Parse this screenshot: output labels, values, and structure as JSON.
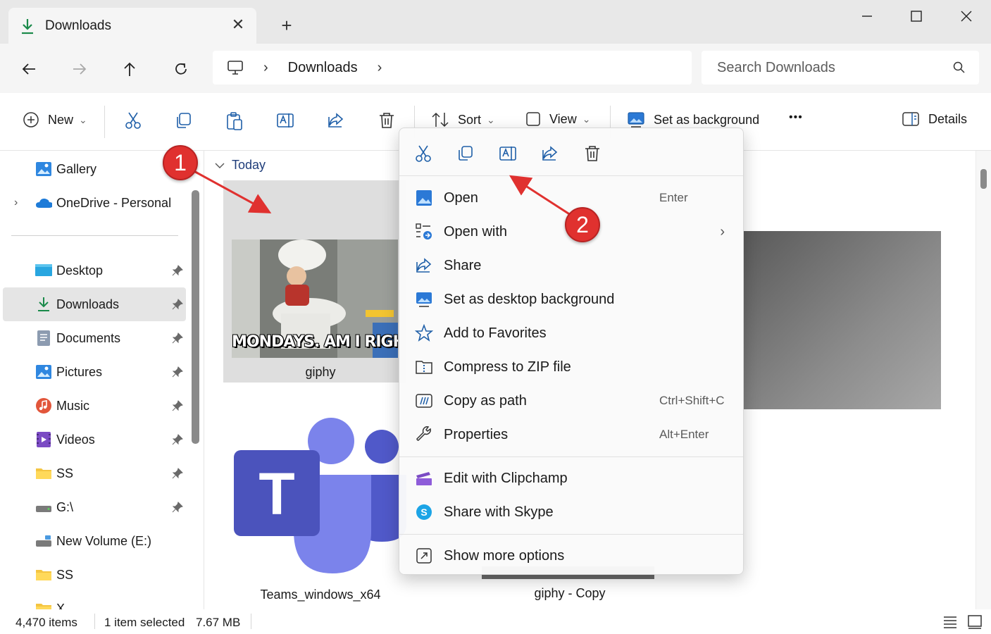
{
  "window": {
    "tab_title": "Downloads",
    "tab_close": "✕",
    "new_tab": "+"
  },
  "address": {
    "crumb": "Downloads",
    "sep1": "›",
    "sep2": "›",
    "search_placeholder": "Search Downloads"
  },
  "toolbar": {
    "new_label": "New",
    "sort_label": "Sort",
    "view_label": "View",
    "background_label": "Set as background",
    "more_label": "•••",
    "details_label": "Details",
    "chevron": "⌄"
  },
  "sidebar": {
    "items": [
      {
        "label": "Gallery"
      },
      {
        "label": "OneDrive - Personal"
      },
      {
        "label": "Desktop"
      },
      {
        "label": "Downloads"
      },
      {
        "label": "Documents"
      },
      {
        "label": "Pictures"
      },
      {
        "label": "Music"
      },
      {
        "label": "Videos"
      },
      {
        "label": "SS"
      },
      {
        "label": "G:\\"
      },
      {
        "label": "New Volume (E:)"
      },
      {
        "label": "SS"
      },
      {
        "label": "X"
      }
    ],
    "expander": "›"
  },
  "content": {
    "group_header": "Today",
    "files": [
      {
        "name": "giphy"
      },
      {
        "name": "Teams_windows_x64"
      },
      {
        "name": "giphy - Copy"
      }
    ],
    "giphy_caption": "MONDAYS. AM I RIGHT?",
    "teams_letter": "T"
  },
  "status": {
    "items_count": "4,470 items",
    "selection": "1 item selected",
    "size": "7.67 MB"
  },
  "context_menu": {
    "items": [
      {
        "label": "Open",
        "shortcut": "Enter"
      },
      {
        "label": "Open with",
        "arrow": "›"
      },
      {
        "label": "Share"
      },
      {
        "label": "Set as desktop background"
      },
      {
        "label": "Add to Favorites"
      },
      {
        "label": "Compress to ZIP file"
      },
      {
        "label": "Copy as path",
        "shortcut": "Ctrl+Shift+C"
      },
      {
        "label": "Properties",
        "shortcut": "Alt+Enter"
      },
      {
        "label": "Edit with Clipchamp"
      },
      {
        "label": "Share with Skype"
      },
      {
        "label": "Show more options"
      }
    ]
  },
  "annotations": {
    "badge1": "1",
    "badge2": "2"
  },
  "colors": {
    "accent": "#0f6cbd",
    "teams_purple": "#5b5fc7",
    "badge_red": "#e0312f"
  }
}
